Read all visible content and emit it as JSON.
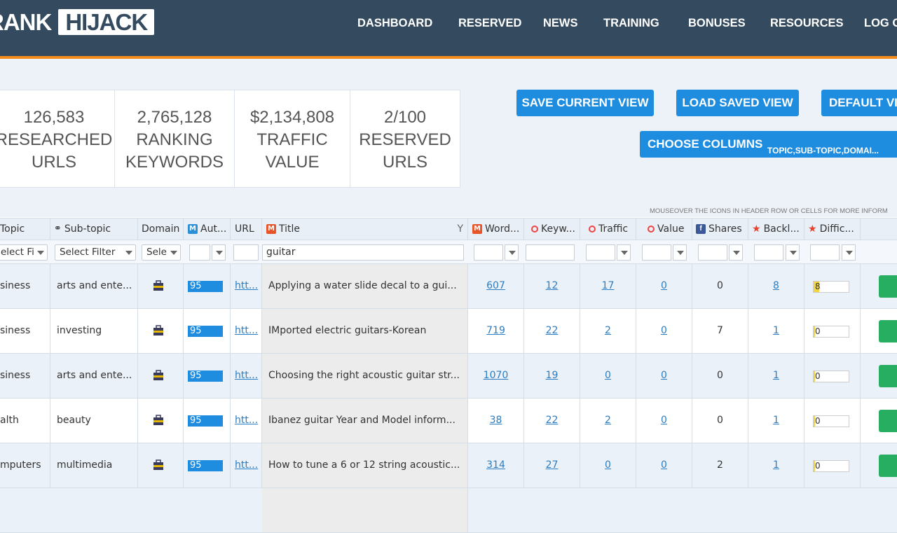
{
  "logo": {
    "part1": "RANK",
    "part2": "HIJACK"
  },
  "nav": [
    "DASHBOARD",
    "RESERVED",
    "NEWS",
    "TRAINING",
    "BONUSES",
    "RESOURCES",
    "LOG O"
  ],
  "stats": [
    {
      "value": "126,583",
      "line1": "RESEARCHED",
      "line2": "URLS"
    },
    {
      "value": "2,765,128",
      "line1": "RANKING",
      "line2": "KEYWORDS"
    },
    {
      "value": "$2,134,808",
      "line1": "TRAFFIC",
      "line2": "VALUE"
    },
    {
      "value": "2/100",
      "line1": "RESERVED",
      "line2": "URLS"
    }
  ],
  "buttons": {
    "save_view": "SAVE CURRENT VIEW",
    "load_view": "LOAD SAVED VIEW",
    "default_view": "DEFAULT VI",
    "choose_columns": "CHOOSE COLUMNS",
    "columns_value": "TOPIC,SUB-TOPIC,DOMAI..."
  },
  "hint": "MOUSEOVER THE ICONS IN HEADER ROW OR CELLS FOR MORE INFORM",
  "columns": {
    "topic": "Topic",
    "subtopic": "Sub-topic",
    "domain": "Domain",
    "authority": "Aut...",
    "url": "URL",
    "title": "Title",
    "words": "Word...",
    "keywords": "Keyw...",
    "traffic": "Traffic",
    "value": "Value",
    "shares": "Shares",
    "backlinks": "Backl...",
    "difficulty": "Diffic..."
  },
  "filters": {
    "topic": "elect Fi",
    "subtopic": "Select Filter",
    "domain": "Sele",
    "title_query": "guitar"
  },
  "rows": [
    {
      "topic": "siness",
      "subtopic": "arts and ente...",
      "authority": "95",
      "url": "htt...",
      "title": "Applying a water slide decal to a gui...",
      "words": "607",
      "keywords": "12",
      "traffic": "17",
      "value": "0",
      "shares": "0",
      "backlinks": "8",
      "difficulty": "8"
    },
    {
      "topic": "siness",
      "subtopic": "investing",
      "authority": "95",
      "url": "htt...",
      "title": "IMported electric guitars-Korean",
      "words": "719",
      "keywords": "22",
      "traffic": "2",
      "value": "0",
      "shares": "7",
      "backlinks": "1",
      "difficulty": "0"
    },
    {
      "topic": "siness",
      "subtopic": "arts and ente...",
      "authority": "95",
      "url": "htt...",
      "title": "Choosing the right acoustic guitar str...",
      "words": "1070",
      "keywords": "19",
      "traffic": "0",
      "value": "0",
      "shares": "0",
      "backlinks": "1",
      "difficulty": "0"
    },
    {
      "topic": "alth",
      "subtopic": "beauty",
      "authority": "95",
      "url": "htt...",
      "title": "Ibanez guitar Year and Model inform...",
      "words": "38",
      "keywords": "22",
      "traffic": "2",
      "value": "0",
      "shares": "0",
      "backlinks": "1",
      "difficulty": "0"
    },
    {
      "topic": "mputers",
      "subtopic": "multimedia",
      "authority": "95",
      "url": "htt...",
      "title": "How to tune a 6 or 12 string acoustic...",
      "words": "314",
      "keywords": "27",
      "traffic": "0",
      "value": "0",
      "shares": "2",
      "backlinks": "1",
      "difficulty": "0"
    }
  ],
  "colors": {
    "nav_bg": "#344a5f",
    "accent_orange": "#f28c1b",
    "button_blue": "#1e8de0",
    "link_blue": "#2a7dc2",
    "go_green": "#27ae60"
  }
}
